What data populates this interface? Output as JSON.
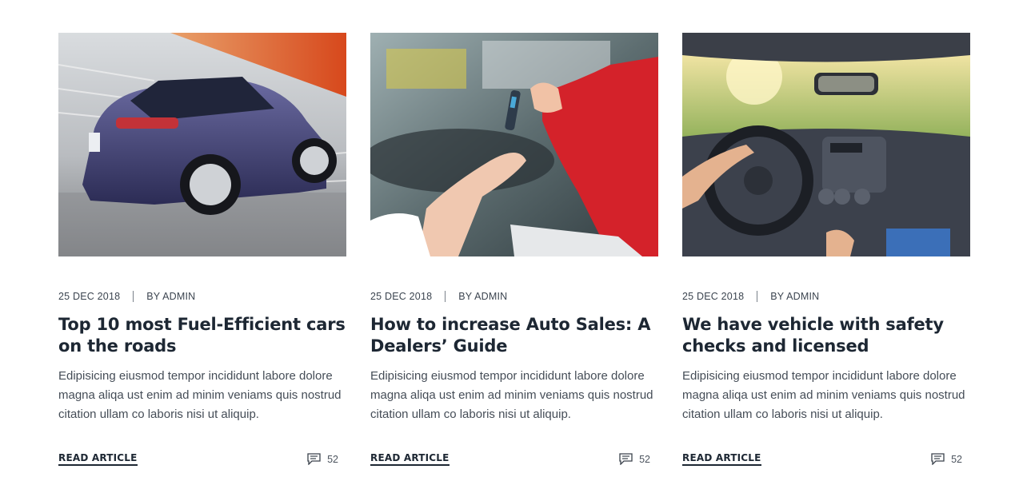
{
  "posts": [
    {
      "date": "25 DEC 2018",
      "author": "BY ADMIN",
      "title": "Top 10 most Fuel-Efficient cars on the roads",
      "excerpt": "Edipisicing eiusmod tempor incididunt labore dolore magna aliqa ust enim ad minim veniams quis nostrud citation ullam co laboris nisi ut aliquip.",
      "read_label": "READ ARTICLE",
      "comment_count": "52",
      "image_icon": "purple-suv-image"
    },
    {
      "date": "25 DEC 2018",
      "author": "BY ADMIN",
      "title": "How to increase Auto Sales: A Dealers’ Guide",
      "excerpt": "Edipisicing eiusmod tempor incididunt labore dolore magna aliqa ust enim ad minim veniams quis nostrud citation ullam co laboris nisi ut aliquip.",
      "read_label": "READ ARTICLE",
      "comment_count": "52",
      "image_icon": "car-key-handover-image"
    },
    {
      "date": "25 DEC 2018",
      "author": "BY ADMIN",
      "title": "We have vehicle with safety checks and licensed",
      "excerpt": "Edipisicing eiusmod tempor incididunt labore dolore magna aliqa ust enim ad minim veniams quis nostrud citation ullam co laboris nisi ut aliquip.",
      "read_label": "READ ARTICLE",
      "comment_count": "52",
      "image_icon": "car-interior-image"
    }
  ],
  "colors": {
    "heading": "#1d2733",
    "text": "#454d57",
    "accent_red": "#e0262d"
  }
}
